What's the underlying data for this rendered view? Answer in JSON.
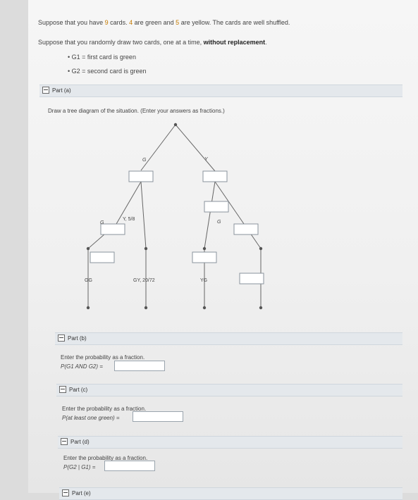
{
  "intro": {
    "p1_a": "Suppose that you have ",
    "p1_b": "9",
    "p1_c": " cards. ",
    "p1_d": "4",
    "p1_e": " are green and ",
    "p1_f": "5",
    "p1_g": " are yellow. The cards are well shuffled.",
    "p2_a": "Suppose that you randomly draw two cards, one at a time, ",
    "p2_b": "without replacement",
    "p2_c": ".",
    "bullets": [
      "G1 = first card is green",
      "G2 = second card is green"
    ]
  },
  "part_a": {
    "title": "Part (a)",
    "prompt": "Draw a tree diagram of the situation. (Enter your answers as fractions.)",
    "labels": {
      "g_branch": "G",
      "y_branch": "Y",
      "left_g": "G",
      "y58": "Y, 5/8",
      "right_g": "G",
      "gg": "GG",
      "gy": "GY, 20/72",
      "yg": "YG"
    }
  },
  "part_b": {
    "title": "Part (b)",
    "prompt": "Enter the probability as a fraction.",
    "expr": "P(G1 AND G2) ="
  },
  "part_c": {
    "title": "Part (c)",
    "prompt": "Enter the probability as a fraction.",
    "expr": "P(at least one green) ="
  },
  "part_d": {
    "title": "Part (d)",
    "prompt": "Enter the probability as a fraction.",
    "expr": "P(G2 | G1) ="
  },
  "part_e": {
    "title": "Part (e)"
  }
}
